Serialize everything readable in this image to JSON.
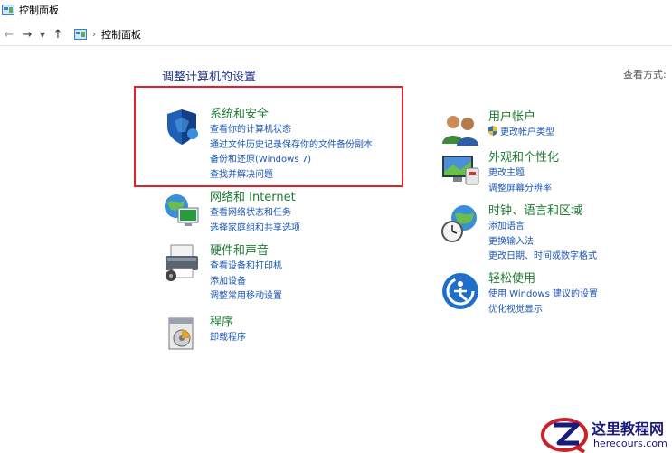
{
  "window": {
    "title": "控制面板"
  },
  "nav": {
    "breadcrumb": "控制面板"
  },
  "main": {
    "heading": "调整计算机的设置",
    "view_by_label": "查看方式:"
  },
  "categories": {
    "system": {
      "title": "系统和安全",
      "links": [
        "查看你的计算机状态",
        "通过文件历史记录保存你的文件备份副本",
        "备份和还原(Windows 7)",
        "查找并解决问题"
      ]
    },
    "network": {
      "title": "网络和 Internet",
      "links": [
        "查看网络状态和任务",
        "选择家庭组和共享选项"
      ]
    },
    "hardware": {
      "title": "硬件和声音",
      "links": [
        "查看设备和打印机",
        "添加设备",
        "调整常用移动设置"
      ]
    },
    "programs": {
      "title": "程序",
      "links": [
        "卸载程序"
      ]
    },
    "users": {
      "title": "用户帐户",
      "links": [
        "更改帐户类型"
      ]
    },
    "appearance": {
      "title": "外观和个性化",
      "links": [
        "更改主题",
        "调整屏幕分辨率"
      ]
    },
    "clock": {
      "title": "时钟、语言和区域",
      "links": [
        "添加语言",
        "更换输入法",
        "更改日期、时间或数字格式"
      ]
    },
    "ease": {
      "title": "轻松使用",
      "links": [
        "使用 Windows 建议的设置",
        "优化视觉显示"
      ]
    }
  },
  "watermark": {
    "name": "这里教程网",
    "url": "herecours.com"
  },
  "colors": {
    "category_title": "#1e7a32",
    "link": "#1a56b4",
    "heading": "#1e3287",
    "highlight_border": "#e0202a"
  }
}
